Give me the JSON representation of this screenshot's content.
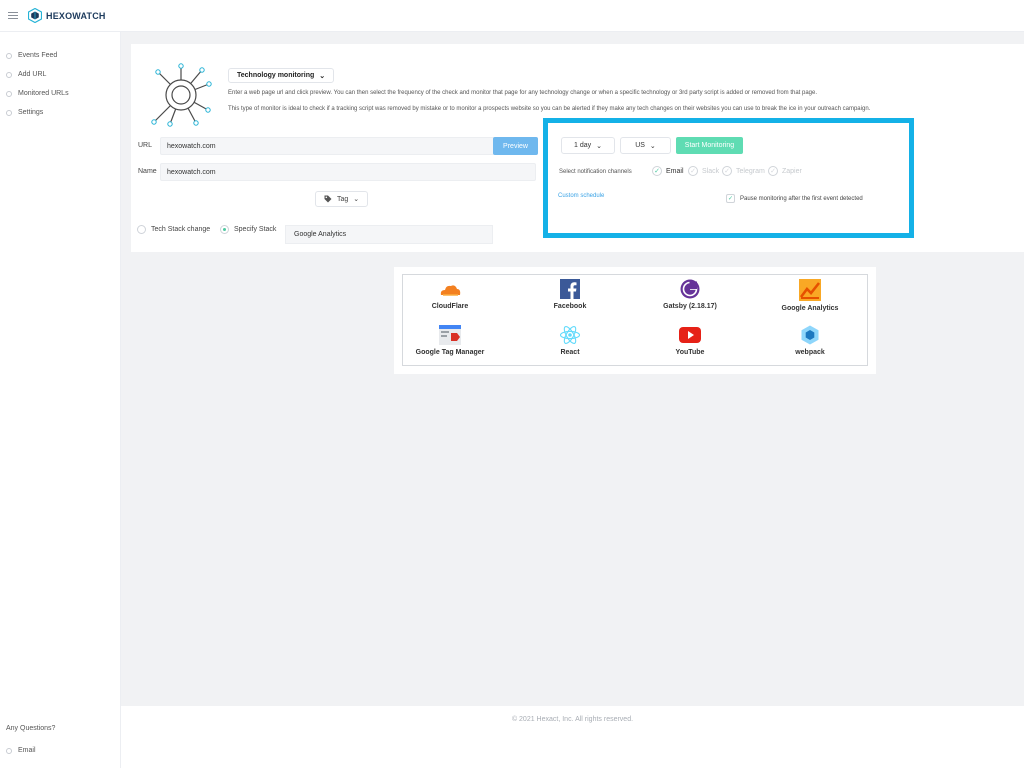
{
  "app": {
    "name": "HEXOWATCH"
  },
  "sidebar": {
    "items": [
      {
        "label": "Events Feed"
      },
      {
        "label": "Add URL"
      },
      {
        "label": "Monitored URLs"
      },
      {
        "label": "Settings"
      }
    ],
    "questions": "Any Questions?",
    "email": "Email"
  },
  "monitor": {
    "type_label": "Technology monitoring",
    "description1": "Enter a web page url and click preview. You can then select the frequency of the check and monitor that page for any technology change or when a specific technology or 3rd party script is added or removed from that page.",
    "description2": "This type of monitor is ideal to check if a tracking script was removed by mistake or to monitor a prospects website so you can be alerted if they make any tech changes on their websites you can use to break the ice in your outreach campaign.",
    "url_label": "URL",
    "url_value": "hexowatch.com",
    "name_label": "Name",
    "name_value": "hexowatch.com",
    "preview_label": "Preview",
    "tag_label": "Tag",
    "radio_tech_change": "Tech Stack change",
    "radio_specify": "Specify Stack",
    "stack_value": "Google Analytics"
  },
  "settings": {
    "frequency": "1 day",
    "region": "US",
    "start_label": "Start Monitoring",
    "notif_label": "Select notification channels",
    "channels": [
      {
        "label": "Email",
        "checked": true
      },
      {
        "label": "Slack",
        "checked": false
      },
      {
        "label": "Telegram",
        "checked": false
      },
      {
        "label": "Zapier",
        "checked": false
      }
    ],
    "custom_schedule": "Custom schedule",
    "pause_label": "Pause monitoring after the first event detected"
  },
  "tech": [
    {
      "label": "CloudFlare",
      "icon": "cloudflare-icon",
      "color": "#f38020"
    },
    {
      "label": "Facebook",
      "icon": "facebook-icon",
      "color": "#1877f2"
    },
    {
      "label": "Gatsby (2.18.17)",
      "icon": "gatsby-icon",
      "color": "#663399"
    },
    {
      "label": "Google Analytics",
      "icon": "google-analytics-icon",
      "color": "#f57c00"
    },
    {
      "label": "Google Tag Manager",
      "icon": "google-tag-manager-icon",
      "color": "#4285f4"
    },
    {
      "label": "React",
      "icon": "react-icon",
      "color": "#61dafb"
    },
    {
      "label": "YouTube",
      "icon": "youtube-icon",
      "color": "#e62117"
    },
    {
      "label": "webpack",
      "icon": "webpack-icon",
      "color": "#8ed6fb"
    }
  ],
  "footer": {
    "text": "© 2021 Hexact, Inc. All rights reserved."
  },
  "colors": {
    "accent": "#14b1e7",
    "green": "#5fdcb3",
    "preview": "#6fb8ee"
  }
}
